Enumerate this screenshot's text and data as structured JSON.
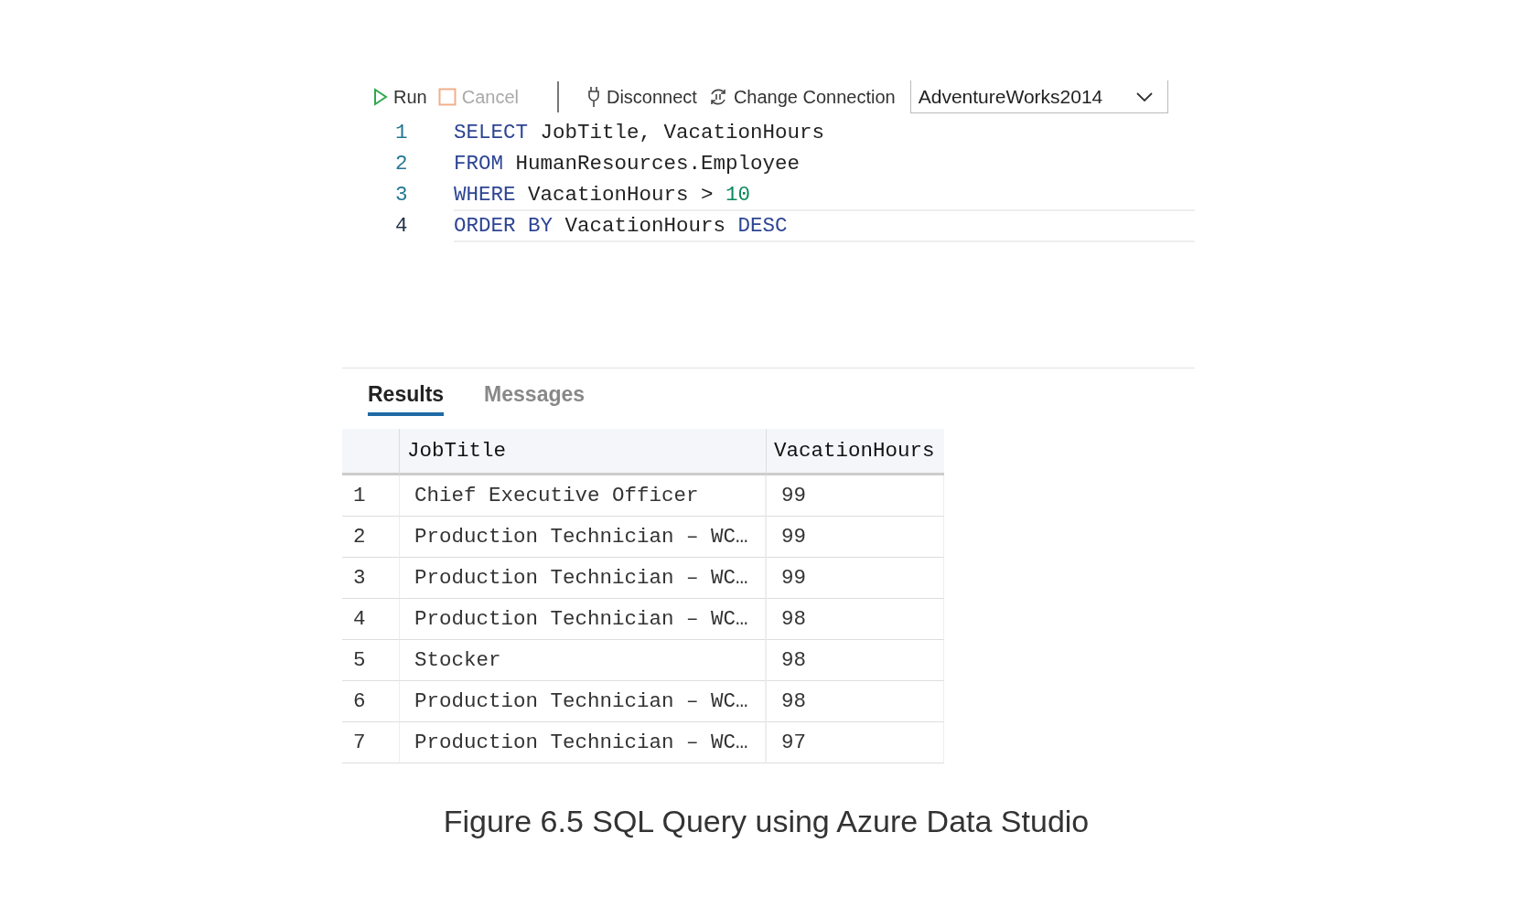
{
  "toolbar": {
    "run": {
      "label": "Run",
      "disabled": false
    },
    "cancel": {
      "label": "Cancel",
      "disabled": true
    },
    "disconnect": "Disconnect",
    "change_connection": "Change Connection",
    "database": "AdventureWorks2014"
  },
  "editor": {
    "lines": [
      {
        "number": "1",
        "current": false,
        "tokens": [
          {
            "text": "SELECT",
            "kind": "keyword"
          },
          {
            "text": " JobTitle, VacationHours",
            "kind": "plain"
          }
        ]
      },
      {
        "number": "2",
        "current": false,
        "tokens": [
          {
            "text": "FROM",
            "kind": "keyword"
          },
          {
            "text": " HumanResources.Employee",
            "kind": "plain"
          }
        ]
      },
      {
        "number": "3",
        "current": false,
        "tokens": [
          {
            "text": "WHERE",
            "kind": "keyword"
          },
          {
            "text": " VacationHours > ",
            "kind": "plain"
          },
          {
            "text": "10",
            "kind": "number"
          }
        ]
      },
      {
        "number": "4",
        "current": true,
        "tokens": [
          {
            "text": "ORDER BY",
            "kind": "keyword"
          },
          {
            "text": " VacationHours ",
            "kind": "plain"
          },
          {
            "text": "DESC",
            "kind": "keyword"
          }
        ]
      }
    ]
  },
  "tabs": [
    {
      "label": "Results",
      "selected": true
    },
    {
      "label": "Messages",
      "selected": false
    }
  ],
  "table": {
    "columns": [
      "JobTitle",
      "VacationHours"
    ],
    "rows": [
      {
        "number": "1",
        "cells": [
          "Chief Executive Officer",
          "99"
        ]
      },
      {
        "number": "2",
        "cells": [
          "Production Technician – WC…",
          "99"
        ]
      },
      {
        "number": "3",
        "cells": [
          "Production Technician – WC…",
          "99"
        ]
      },
      {
        "number": "4",
        "cells": [
          "Production Technician – WC…",
          "98"
        ]
      },
      {
        "number": "5",
        "cells": [
          "Stocker",
          "98"
        ]
      },
      {
        "number": "6",
        "cells": [
          "Production Technician – WC…",
          "98"
        ]
      },
      {
        "number": "7",
        "cells": [
          "Production Technician – WC…",
          "97"
        ]
      }
    ]
  },
  "caption": "Figure 6.5 SQL Query using Azure Data Studio"
}
